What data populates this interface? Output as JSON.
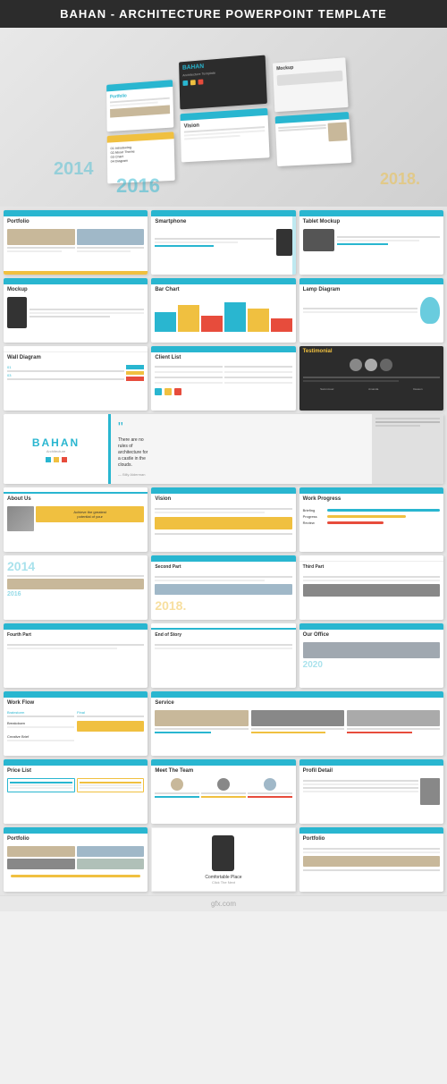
{
  "header": {
    "title": "BAHAN - ARCHITECTURE POWERPOINT TEMPLATE"
  },
  "slides": [
    {
      "id": "mockup",
      "label": "Mockup",
      "type": "hero"
    },
    {
      "id": "portfolio",
      "label": "Portfolio",
      "type": "portfolio"
    },
    {
      "id": "smartphone",
      "label": "Smartphone",
      "type": "smartphone"
    },
    {
      "id": "tablet",
      "label": "Tablet Mockup",
      "type": "tablet"
    },
    {
      "id": "mockup2",
      "label": "Mockup",
      "type": "mockup2"
    },
    {
      "id": "barchart",
      "label": "Bar Chart",
      "type": "barchart"
    },
    {
      "id": "lamp",
      "label": "Lamp Diagram",
      "type": "lamp"
    },
    {
      "id": "wall",
      "label": "Wall Diagram",
      "type": "wall"
    },
    {
      "id": "clientlist",
      "label": "Client List",
      "type": "clientlist"
    },
    {
      "id": "testimonial",
      "label": "Testimonial",
      "type": "testimonial"
    },
    {
      "id": "bahan-quote",
      "label": "BAHAN",
      "type": "bahan-quote"
    },
    {
      "id": "about",
      "label": "About Us",
      "type": "about"
    },
    {
      "id": "vision",
      "label": "Vision",
      "type": "vision"
    },
    {
      "id": "workprogress",
      "label": "Work Progress",
      "type": "workprogress"
    },
    {
      "id": "2014",
      "label": "2014",
      "type": "year"
    },
    {
      "id": "second",
      "label": "Second Part",
      "type": "second"
    },
    {
      "id": "third",
      "label": "Third Part",
      "type": "third"
    },
    {
      "id": "fourth",
      "label": "Fourth Part",
      "type": "fourth"
    },
    {
      "id": "ouroffice",
      "label": "Our Office",
      "type": "ouroffice"
    },
    {
      "id": "workflow",
      "label": "Work Flow",
      "type": "workflow"
    },
    {
      "id": "service",
      "label": "Service",
      "type": "service"
    },
    {
      "id": "pricelist",
      "label": "Price List",
      "type": "pricelist"
    },
    {
      "id": "meetteam",
      "label": "Meet The Team",
      "type": "meetteam"
    },
    {
      "id": "profil",
      "label": "Profil Detail",
      "type": "profil"
    },
    {
      "id": "portfolio2",
      "label": "Portfolio",
      "type": "portfolio2"
    },
    {
      "id": "portfolio3",
      "label": "Portfolio",
      "type": "portfolio3"
    }
  ],
  "colors": {
    "blue": "#29b6d0",
    "yellow": "#f0c040",
    "dark": "#2c2c2c",
    "light_gray": "#f5f5f5",
    "gray": "#888888"
  },
  "watermark": "gfx.com"
}
